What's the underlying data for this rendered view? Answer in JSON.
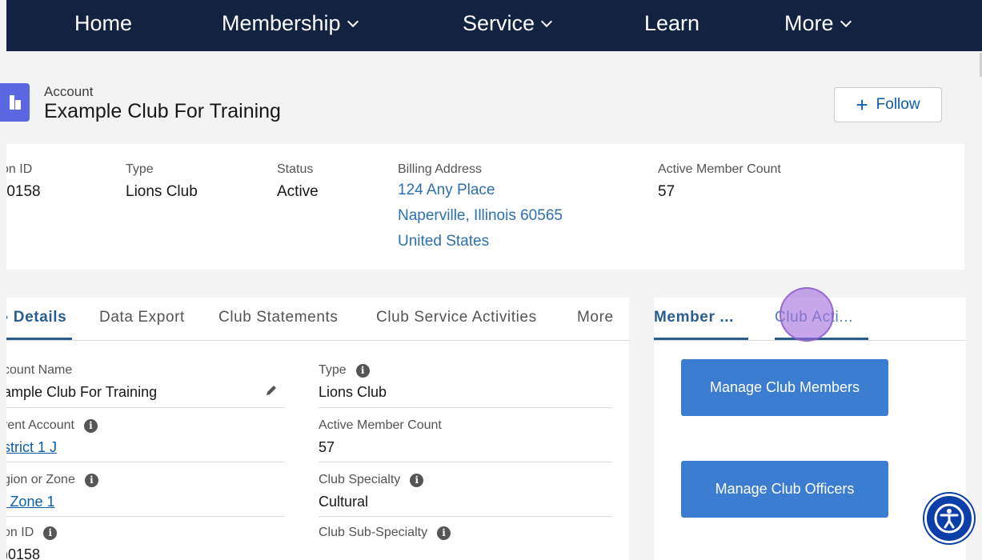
{
  "nav": {
    "items": [
      {
        "label": "Home",
        "dropdown": false
      },
      {
        "label": "Membership",
        "dropdown": true
      },
      {
        "label": "Service",
        "dropdown": true
      },
      {
        "label": "Learn",
        "dropdown": false
      },
      {
        "label": "More",
        "dropdown": true
      }
    ]
  },
  "header": {
    "object_label": "Account",
    "title": "Example Club For Training",
    "follow_label": "Follow",
    "icon": "building-icon"
  },
  "highlights": {
    "id_label": "on ID",
    "id_value": ")0158",
    "type_label": "Type",
    "type_value": "Lions Club",
    "status_label": "Status",
    "status_value": "Active",
    "billing_label": "Billing Address",
    "billing_line1": "124 Any Place",
    "billing_line2": "Naperville, Illinois 60565",
    "billing_line3": "United States",
    "member_count_label": "Active Member Count",
    "member_count_value": "57"
  },
  "tabs": {
    "items": [
      "› Details",
      "Data Export",
      "Club Statements",
      "Club Service Activities",
      "More"
    ],
    "active": 0
  },
  "details": {
    "account_name_label": "count Name",
    "account_name_value": "ample Club For Training",
    "parent_account_label": "rent Account",
    "parent_account_value": "strict 1 J",
    "region_label": "gion or Zone",
    "region_value": "' Zone 1",
    "id_label": "on ID",
    "id_value": ")0158",
    "type_label": "Type",
    "type_value": "Lions Club",
    "active_count_label": "Active Member Count",
    "active_count_value": "57",
    "specialty_label": "Club Specialty",
    "specialty_value": "Cultural",
    "sub_specialty_label": "Club Sub-Specialty"
  },
  "right_panel": {
    "tabs": [
      "Member ...",
      "Club Acti..."
    ],
    "active": 1,
    "buttons": {
      "manage_members": "Manage Club Members",
      "manage_officers": "Manage Club Officers"
    }
  },
  "colors": {
    "nav_bg": "#112341",
    "brand_icon": "#5a67e0",
    "link": "#2e6fb0",
    "button": "#3b7dd1",
    "tab_active": "#2a5d8f",
    "a11y_widget": "#0b3ea8"
  }
}
